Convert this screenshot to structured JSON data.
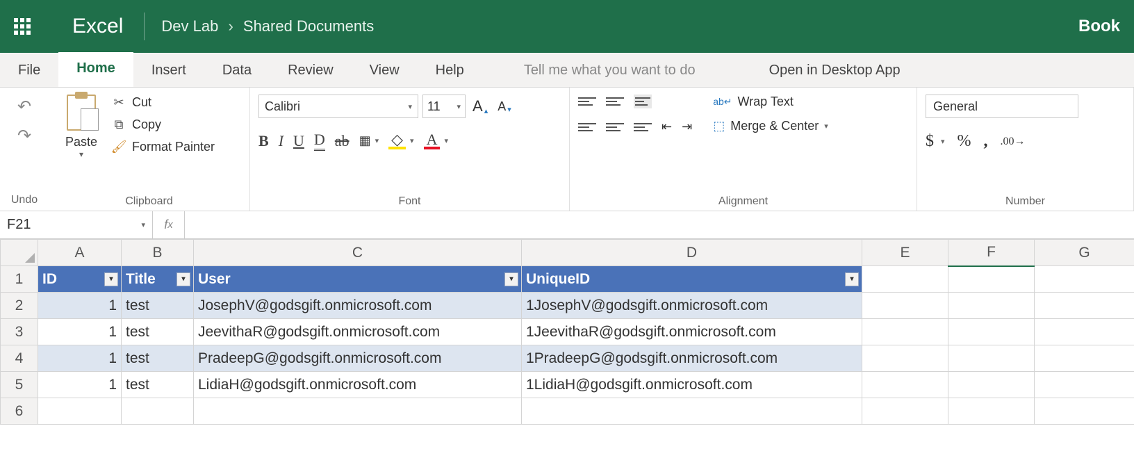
{
  "header": {
    "app": "Excel",
    "breadcrumb1": "Dev Lab",
    "breadcrumb2": "Shared Documents",
    "doc": "Book"
  },
  "tabs": {
    "file": "File",
    "home": "Home",
    "insert": "Insert",
    "data": "Data",
    "review": "Review",
    "view": "View",
    "help": "Help",
    "tellme": "Tell me what you want to do",
    "desktop": "Open in Desktop App"
  },
  "ribbon": {
    "undo_label": "Undo",
    "clipboard": {
      "paste": "Paste",
      "cut": "Cut",
      "copy": "Copy",
      "format_painter": "Format Painter",
      "group": "Clipboard"
    },
    "font": {
      "name": "Calibri",
      "size": "11",
      "group": "Font"
    },
    "alignment": {
      "wrap": "Wrap Text",
      "merge": "Merge & Center",
      "group": "Alignment"
    },
    "number": {
      "format": "General",
      "group": "Number"
    }
  },
  "formula_bar": {
    "cell_ref": "F21",
    "value": ""
  },
  "grid": {
    "columns": [
      "A",
      "B",
      "C",
      "D",
      "E",
      "F",
      "G"
    ],
    "selected_col": "F",
    "headers": [
      "ID",
      "Title",
      "User",
      "UniqueID"
    ],
    "rows": [
      {
        "id": "1",
        "title": "test",
        "user": "JosephV@godsgift.onmicrosoft.com",
        "unique": "1JosephV@godsgift.onmicrosoft.com"
      },
      {
        "id": "1",
        "title": "test",
        "user": "JeevithaR@godsgift.onmicrosoft.com",
        "unique": "1JeevithaR@godsgift.onmicrosoft.com"
      },
      {
        "id": "1",
        "title": "test",
        "user": "PradeepG@godsgift.onmicrosoft.com",
        "unique": "1PradeepG@godsgift.onmicrosoft.com"
      },
      {
        "id": "1",
        "title": "test",
        "user": "LidiaH@godsgift.onmicrosoft.com",
        "unique": "1LidiaH@godsgift.onmicrosoft.com"
      }
    ]
  }
}
